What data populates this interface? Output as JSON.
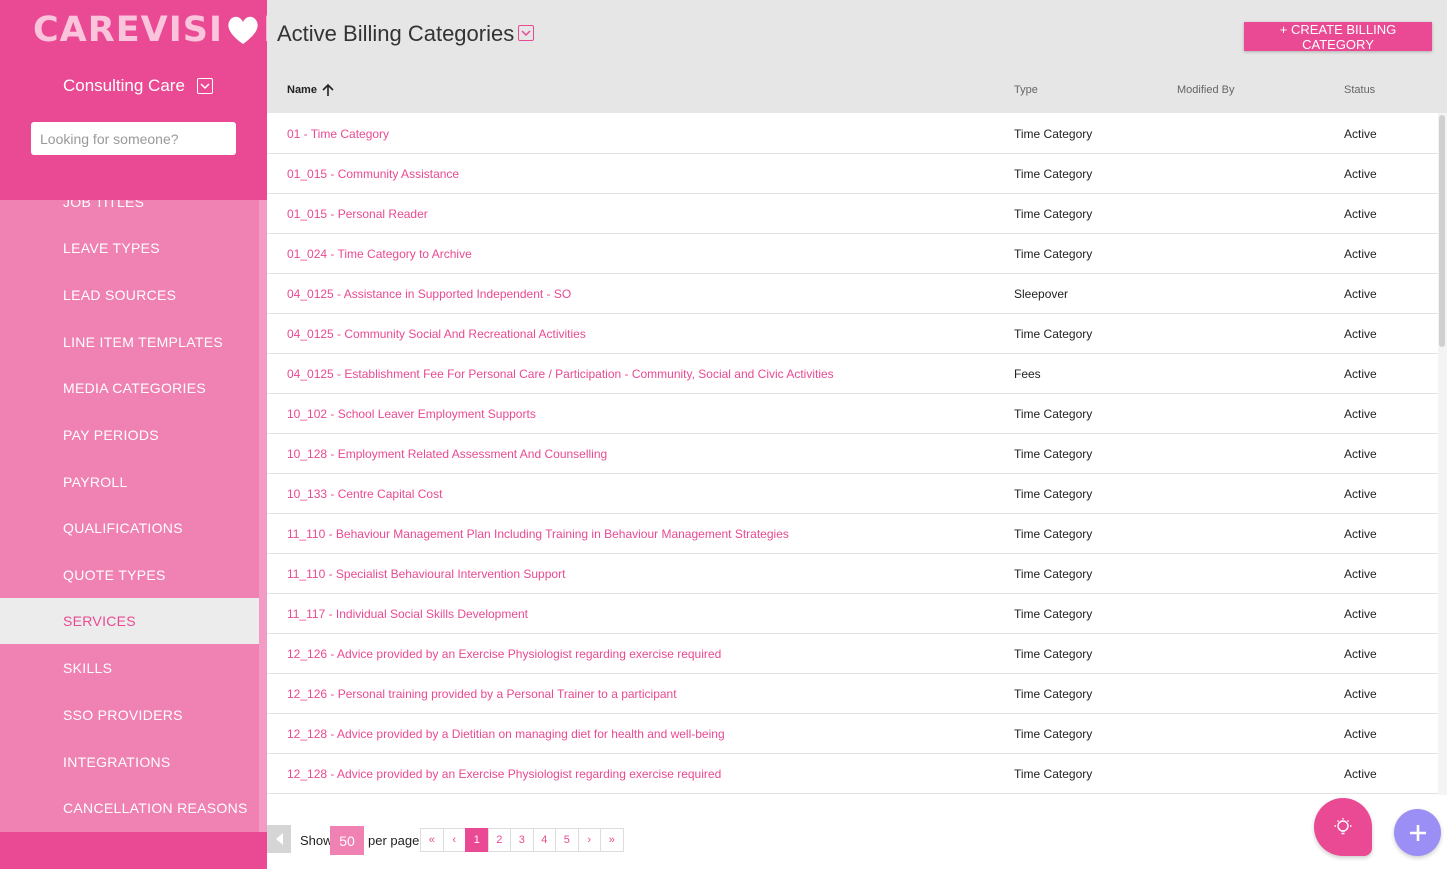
{
  "brand": {
    "logo_left": "CAREVISI",
    "logo_right": "N",
    "org_name": "Consulting Care"
  },
  "search": {
    "placeholder": "Looking for someone?"
  },
  "sidebar": {
    "items": [
      {
        "label": "JOB TITLES"
      },
      {
        "label": "LEAVE TYPES"
      },
      {
        "label": "LEAD SOURCES"
      },
      {
        "label": "LINE ITEM TEMPLATES"
      },
      {
        "label": "MEDIA CATEGORIES"
      },
      {
        "label": "PAY PERIODS"
      },
      {
        "label": "PAYROLL"
      },
      {
        "label": "QUALIFICATIONS"
      },
      {
        "label": "QUOTE TYPES"
      },
      {
        "label": "SERVICES",
        "active": true
      },
      {
        "label": "SKILLS"
      },
      {
        "label": "SSO PROVIDERS"
      },
      {
        "label": "INTEGRATIONS"
      },
      {
        "label": "CANCELLATION REASONS"
      }
    ]
  },
  "header": {
    "title": "Active Billing Categories",
    "create_label": "+ CREATE BILLING CATEGORY"
  },
  "table": {
    "columns": {
      "name": "Name",
      "type": "Type",
      "modified_by": "Modified By",
      "status": "Status"
    },
    "rows": [
      {
        "name": "01 - Time Category",
        "type": "Time Category",
        "status": "Active"
      },
      {
        "name": "01_015 - Community Assistance",
        "type": "Time Category",
        "status": "Active"
      },
      {
        "name": "01_015 - Personal Reader",
        "type": "Time Category",
        "status": "Active"
      },
      {
        "name": "01_024 - Time Category to Archive",
        "type": "Time Category",
        "status": "Active"
      },
      {
        "name": "04_0125 - Assistance in Supported Independent - SO",
        "type": "Sleepover",
        "status": "Active"
      },
      {
        "name": "04_0125 - Community Social And Recreational Activities",
        "type": "Time Category",
        "status": "Active"
      },
      {
        "name": "04_0125 - Establishment Fee For Personal Care / Participation - Community, Social and Civic Activities",
        "type": "Fees",
        "status": "Active"
      },
      {
        "name": "10_102 - School Leaver Employment Supports",
        "type": "Time Category",
        "status": "Active"
      },
      {
        "name": "10_128 - Employment Related Assessment And Counselling",
        "type": "Time Category",
        "status": "Active"
      },
      {
        "name": "10_133 - Centre Capital Cost",
        "type": "Time Category",
        "status": "Active"
      },
      {
        "name": "11_110 - Behaviour Management Plan Including Training in Behaviour Management Strategies",
        "type": "Time Category",
        "status": "Active"
      },
      {
        "name": "11_110 - Specialist Behavioural Intervention Support",
        "type": "Time Category",
        "status": "Active"
      },
      {
        "name": "11_117 - Individual Social Skills Development",
        "type": "Time Category",
        "status": "Active"
      },
      {
        "name": "12_126 - Advice provided by an Exercise Physiologist regarding exercise required",
        "type": "Time Category",
        "status": "Active"
      },
      {
        "name": "12_126 - Personal training provided by a Personal Trainer to a participant",
        "type": "Time Category",
        "status": "Active"
      },
      {
        "name": "12_128 - Advice provided by a Dietitian on managing diet for health and well-being",
        "type": "Time Category",
        "status": "Active"
      },
      {
        "name": "12_128 - Advice provided by an Exercise Physiologist regarding exercise required",
        "type": "Time Category",
        "status": "Active"
      }
    ]
  },
  "pagination": {
    "show_label": "Show",
    "per_page_value": "50",
    "per_page_label": "per page",
    "first": "«",
    "prev": "‹",
    "pages": [
      "1",
      "2",
      "3",
      "4",
      "5"
    ],
    "active_page": "1",
    "next": "›",
    "last": "»"
  },
  "colors": {
    "brand_pink": "#e94a93",
    "sidebar_list": "#ef81b3",
    "fab_purple": "#9b8ef5"
  }
}
